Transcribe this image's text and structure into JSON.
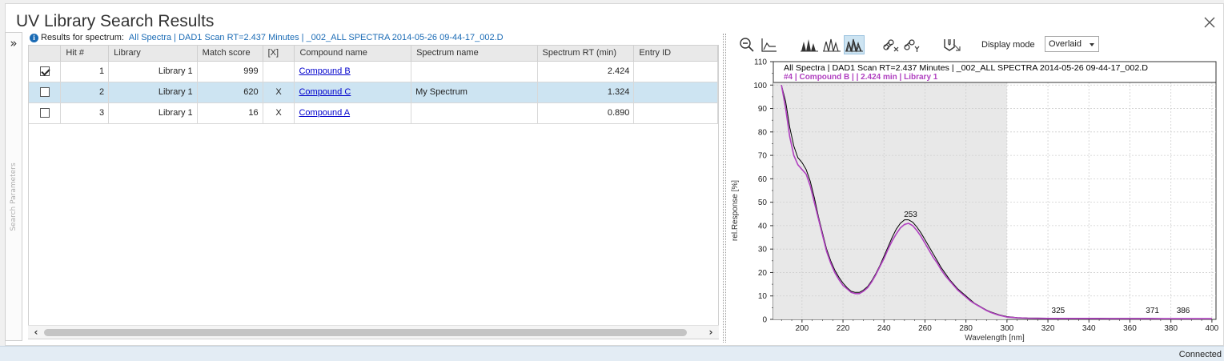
{
  "window": {
    "title": "UV Library Search Results"
  },
  "side_panel": {
    "label": "Search Parameters"
  },
  "results": {
    "prefix": "Results for spectrum:",
    "spectrum": "All Spectra | DAD1 Scan RT=2.437 Minutes | _002_ALL SPECTRA 2014-05-26 09-44-17_002.D"
  },
  "table": {
    "columns": [
      "",
      "Hit #",
      "Library",
      "Match score",
      "[X]",
      "Compound name",
      "Spectrum name",
      "Spectrum RT (min)",
      "Entry ID"
    ],
    "rows": [
      {
        "checked": true,
        "hit": "1",
        "library": "Library 1",
        "score": "999",
        "x": "",
        "compound": "Compound B",
        "spectrum_name": "",
        "rt": "2.424",
        "entry_id": ""
      },
      {
        "checked": false,
        "hit": "2",
        "library": "Library 1",
        "score": "620",
        "x": "X",
        "compound": "Compound C",
        "spectrum_name": "My Spectrum",
        "rt": "1.324",
        "entry_id": ""
      },
      {
        "checked": false,
        "hit": "3",
        "library": "Library 1",
        "score": "16",
        "x": "X",
        "compound": "Compound A",
        "spectrum_name": "",
        "rt": "0.890",
        "entry_id": ""
      }
    ],
    "selected_row": 1
  },
  "toolbar": {
    "display_mode_label": "Display mode",
    "display_mode_value": "Overlaid",
    "icons": [
      "zoom-out-icon",
      "spectrum-baseline-icon",
      "peaks-stacked-icon",
      "peaks-outline-icon",
      "peaks-overlaid-icon",
      "link-x-icon",
      "link-y-icon",
      "spectrum-select-icon"
    ],
    "active_icon": "peaks-overlaid-icon"
  },
  "chart_data": {
    "type": "line",
    "legend": [
      {
        "text": "All Spectra | DAD1 Scan RT=2.437 Minutes | _002_ALL SPECTRA 2014-05-26 09-44-17_002.D",
        "color": "#000000"
      },
      {
        "text": "#4 | Compound B |  | 2.424 min | Library 1",
        "color": "#b040c0"
      }
    ],
    "xlabel": "Wavelength [nm]",
    "ylabel": "rel.Response [%]",
    "xlim": [
      186,
      402
    ],
    "ylim": [
      0,
      110
    ],
    "xticks": [
      200,
      220,
      240,
      260,
      280,
      300,
      320,
      340,
      360,
      380,
      400
    ],
    "yticks": [
      0,
      10,
      20,
      30,
      40,
      50,
      60,
      70,
      80,
      90,
      100,
      110
    ],
    "shaded_range": [
      186,
      300
    ],
    "peak_labels": [
      {
        "x": 253,
        "y": 42,
        "text": "253"
      },
      {
        "x": 325,
        "y": 1,
        "text": "325"
      },
      {
        "x": 371,
        "y": 1,
        "text": "371"
      },
      {
        "x": 386,
        "y": 1,
        "text": "386"
      }
    ],
    "series": [
      {
        "color": "#000000",
        "x": [
          190,
          192,
          194,
          196,
          198,
          200,
          202,
          204,
          206,
          208,
          210,
          212,
          214,
          216,
          218,
          220,
          222,
          224,
          226,
          228,
          230,
          232,
          234,
          236,
          238,
          240,
          242,
          244,
          246,
          248,
          250,
          252,
          253,
          254,
          256,
          258,
          260,
          262,
          264,
          266,
          268,
          270,
          272,
          274,
          276,
          278,
          280,
          282,
          284,
          286,
          288,
          290,
          292,
          294,
          296,
          298,
          300,
          305,
          310,
          320,
          330,
          340,
          350,
          360,
          370,
          380,
          390,
          400
        ],
        "y": [
          100,
          93,
          82,
          74,
          69,
          67,
          64,
          59,
          52,
          44,
          37,
          30,
          25,
          21,
          18,
          15.5,
          13.5,
          12,
          11.5,
          11.5,
          12.5,
          14,
          16.5,
          19.5,
          23,
          27,
          31,
          35,
          38.5,
          41,
          42.5,
          42.5,
          42,
          41.5,
          39.5,
          37,
          34,
          31,
          28,
          25,
          22,
          19.5,
          17,
          15,
          13,
          11.5,
          10,
          8.5,
          7,
          6,
          5,
          4,
          3.2,
          2.6,
          2,
          1.6,
          1.2,
          0.8,
          0.6,
          0.5,
          0.5,
          0.5,
          0.4,
          0.4,
          0.4,
          0.3,
          0.3,
          0.3
        ]
      },
      {
        "color": "#b040c0",
        "x": [
          190,
          192,
          194,
          196,
          198,
          200,
          202,
          204,
          206,
          208,
          210,
          212,
          214,
          216,
          218,
          220,
          222,
          224,
          226,
          228,
          230,
          232,
          234,
          236,
          238,
          240,
          242,
          244,
          246,
          248,
          250,
          252,
          253,
          254,
          256,
          258,
          260,
          262,
          264,
          266,
          268,
          270,
          272,
          274,
          276,
          278,
          280,
          282,
          284,
          286,
          288,
          290,
          292,
          294,
          296,
          298,
          300,
          305,
          310,
          320,
          330,
          340,
          350,
          360,
          370,
          380,
          390,
          400
        ],
        "y": [
          100,
          90,
          78,
          70,
          66,
          64,
          62,
          57,
          50,
          43,
          36,
          29,
          24,
          20,
          17,
          14.5,
          13,
          11.5,
          11,
          11,
          12,
          13.5,
          16,
          19,
          22.5,
          26,
          30,
          33.5,
          36.5,
          39,
          40.5,
          41,
          40.5,
          40,
          38,
          35.5,
          32.5,
          29.5,
          26.5,
          24,
          21,
          18.5,
          16.5,
          14.5,
          12.5,
          11,
          9.5,
          8,
          6.8,
          5.8,
          4.8,
          3.8,
          3,
          2.4,
          1.8,
          1.4,
          1,
          0.7,
          0.5,
          0.4,
          0.4,
          0.4,
          0.3,
          0.3,
          0.3,
          0.3,
          0.3,
          0.3
        ]
      }
    ]
  },
  "status": {
    "text": "Connected"
  }
}
